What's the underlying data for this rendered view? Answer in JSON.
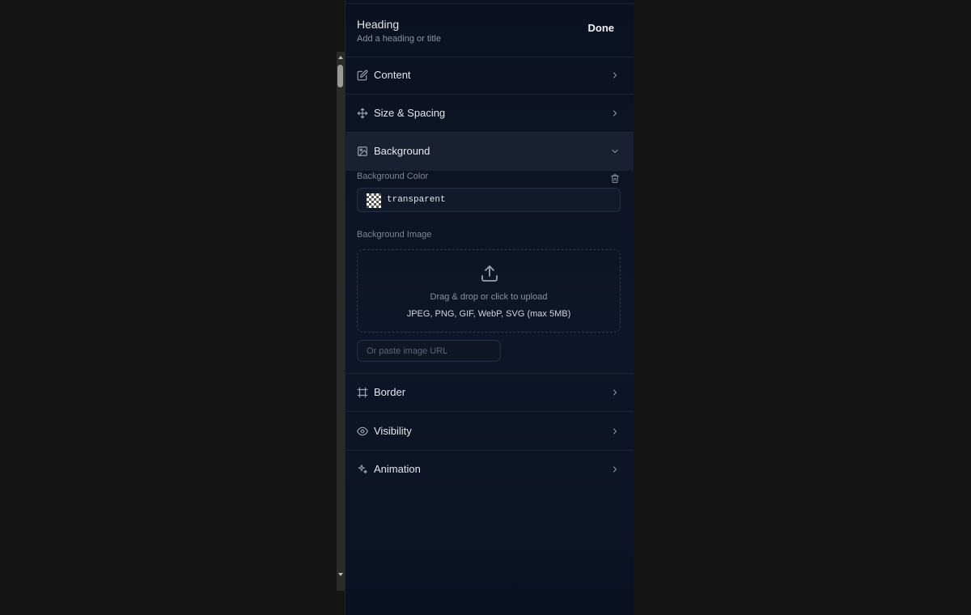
{
  "panel": {
    "header": {
      "title": "Heading",
      "subtitle": "Add a heading or title",
      "done_label": "Done"
    },
    "sections": [
      {
        "id": "content",
        "label": "Content",
        "icon": "edit-icon",
        "expanded": false
      },
      {
        "id": "size-spacing",
        "label": "Size & Spacing",
        "icon": "move-icon",
        "expanded": false
      },
      {
        "id": "background",
        "label": "Background",
        "icon": "image-icon",
        "expanded": true
      },
      {
        "id": "border",
        "label": "Border",
        "icon": "frame-icon",
        "expanded": false
      },
      {
        "id": "visibility",
        "label": "Visibility",
        "icon": "eye-icon",
        "expanded": false
      },
      {
        "id": "animation",
        "label": "Animation",
        "icon": "sparkles-icon",
        "expanded": false
      }
    ],
    "background": {
      "color_label": "Background Color",
      "color_value": "transparent",
      "image_label": "Background Image",
      "dropzone_text": "Drag & drop or click to upload",
      "dropzone_formats": "JPEG, PNG, GIF, WebP, SVG (max 5MB)",
      "url_placeholder": "Or paste image URL",
      "url_value": ""
    }
  },
  "colors": {
    "page_bg": "#141414",
    "panel_bg": "#0b1120",
    "active_section_bg": "#182032",
    "text": "#e5e7eb",
    "muted_text": "#8b93a2",
    "border": "#1d2536"
  }
}
